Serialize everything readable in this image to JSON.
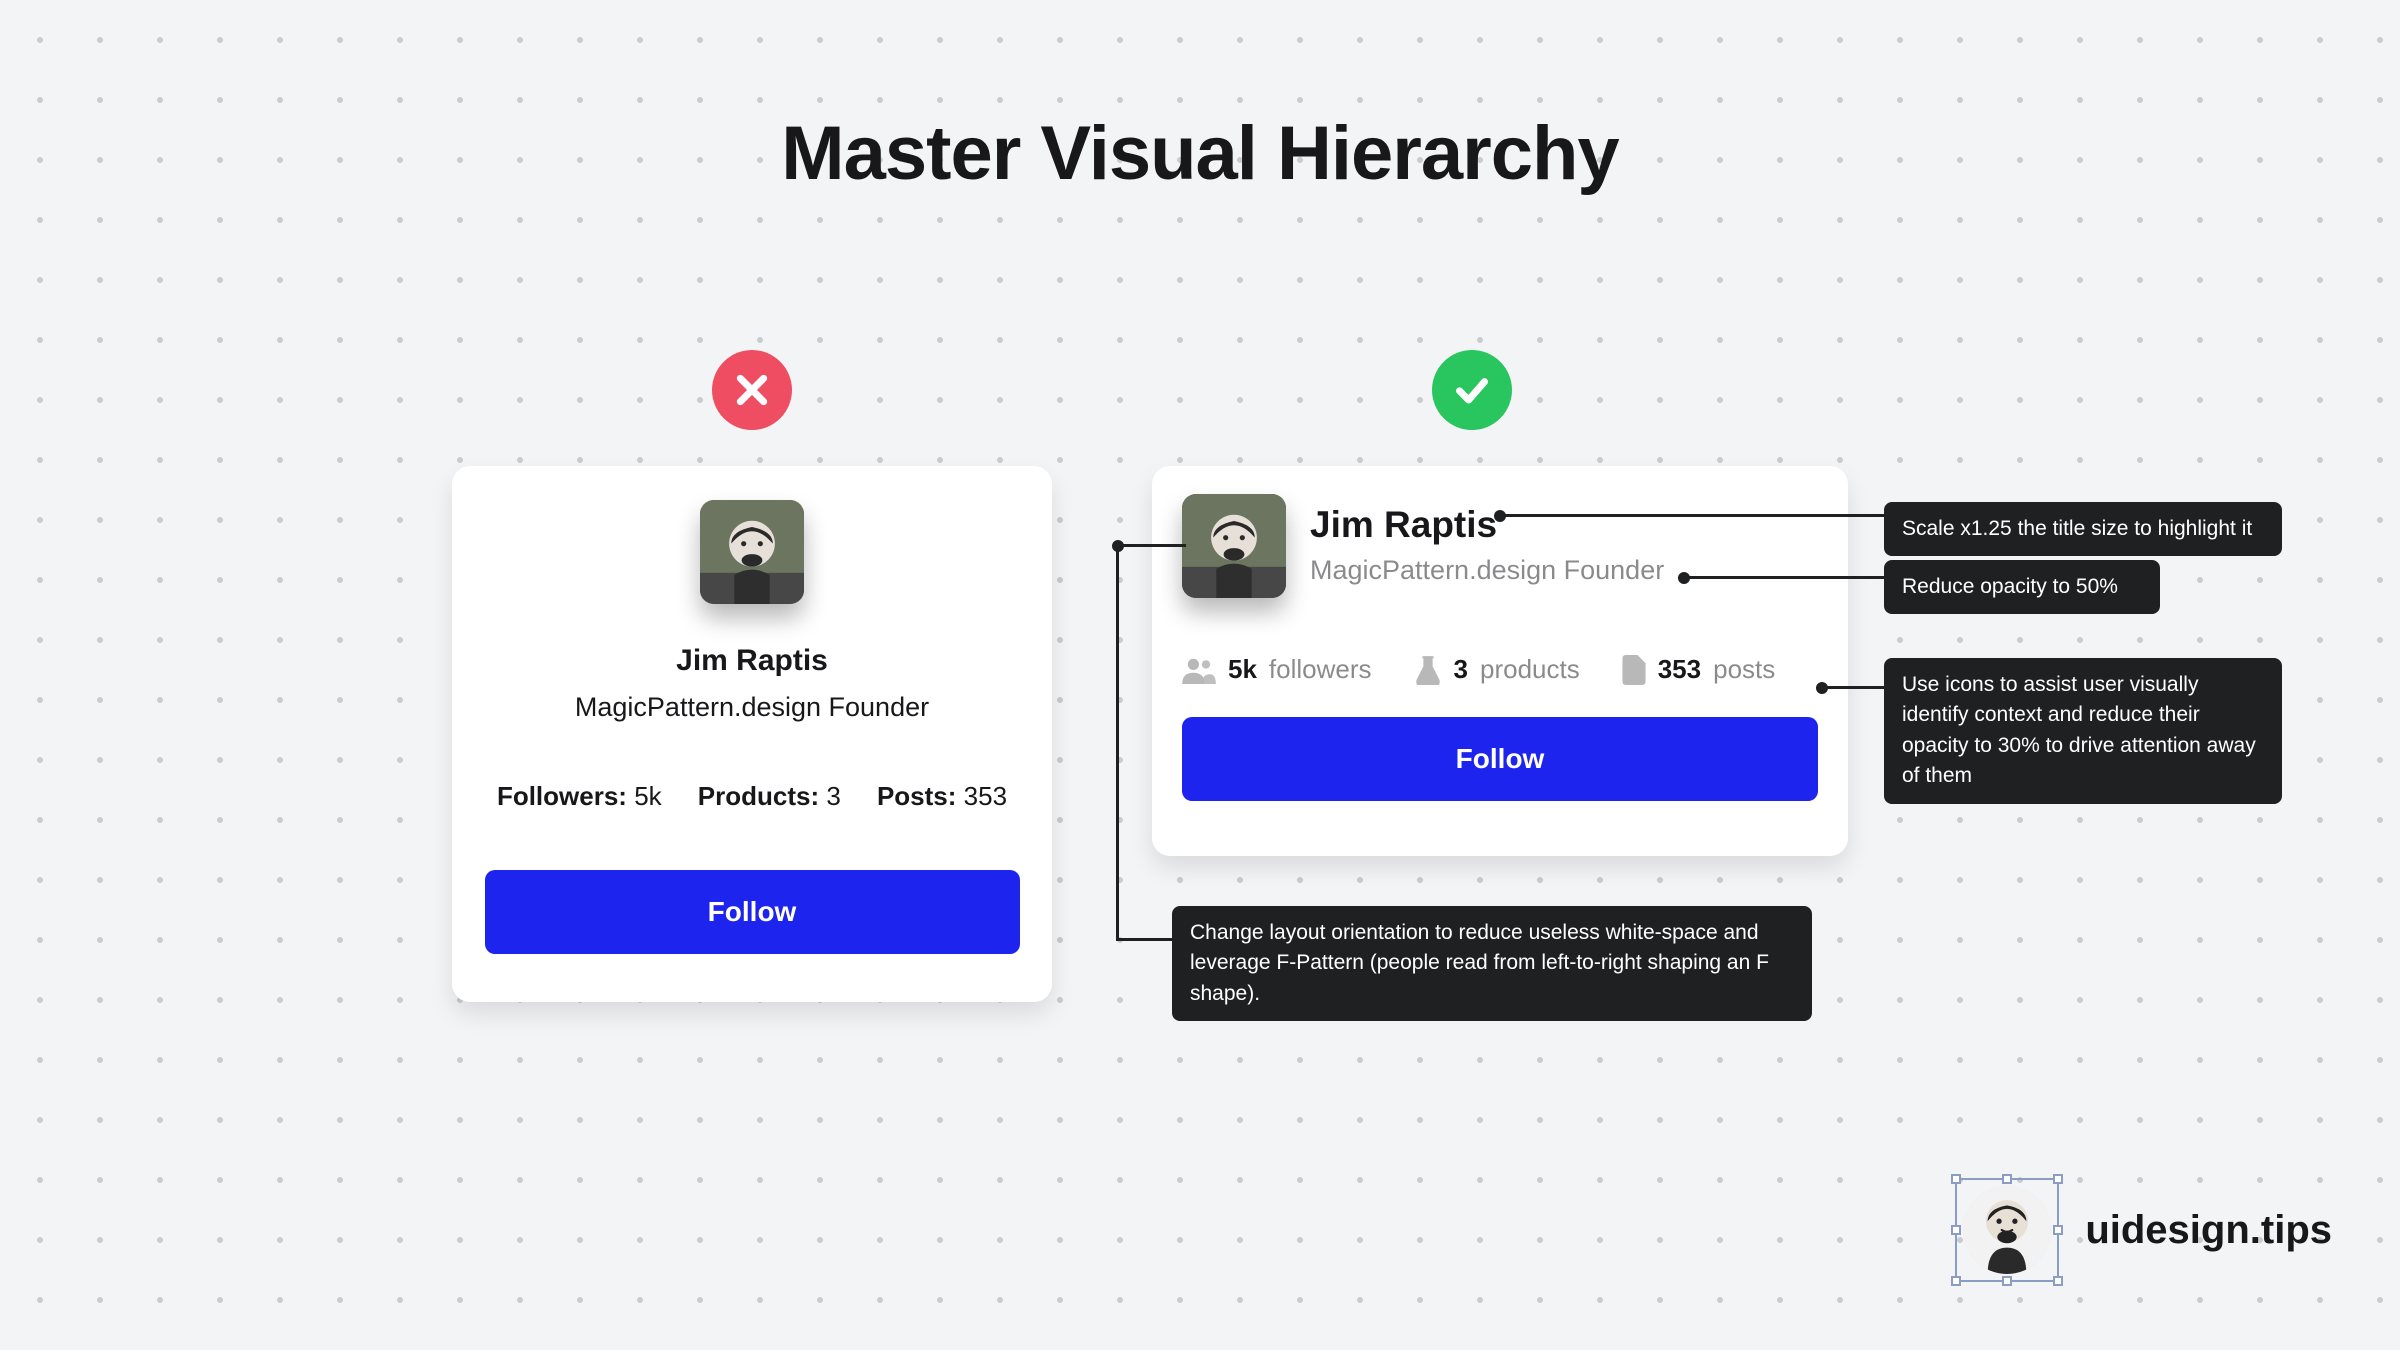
{
  "title": "Master Visual Hierarchy",
  "user": {
    "name": "Jim Raptis",
    "subtitle": "MagicPattern.design Founder"
  },
  "bad_card": {
    "stats": {
      "followers_label": "Followers:",
      "followers_value": "5k",
      "products_label": "Products:",
      "products_value": "3",
      "posts_label": "Posts:",
      "posts_value": "353"
    },
    "follow_label": "Follow"
  },
  "good_card": {
    "stats": {
      "followers_value": "5k",
      "followers_label": "followers",
      "products_value": "3",
      "products_label": "products",
      "posts_value": "353",
      "posts_label": "posts"
    },
    "follow_label": "Follow"
  },
  "annotations": {
    "title_scale": "Scale x1.25 the title size to highlight it",
    "opacity": "Reduce opacity to 50%",
    "icons": "Use icons to assist user visually identify context and reduce their opacity to 30% to drive attention away of them",
    "layout": "Change layout orientation to reduce useless white-space and leverage F-Pattern (people read from left-to-right shaping an F shape)."
  },
  "brand": {
    "name_bold": "uidesign",
    "name_light": ".tips"
  },
  "colors": {
    "bad": "#EF4E62",
    "good": "#29C55E",
    "primary": "#1C24EE"
  }
}
